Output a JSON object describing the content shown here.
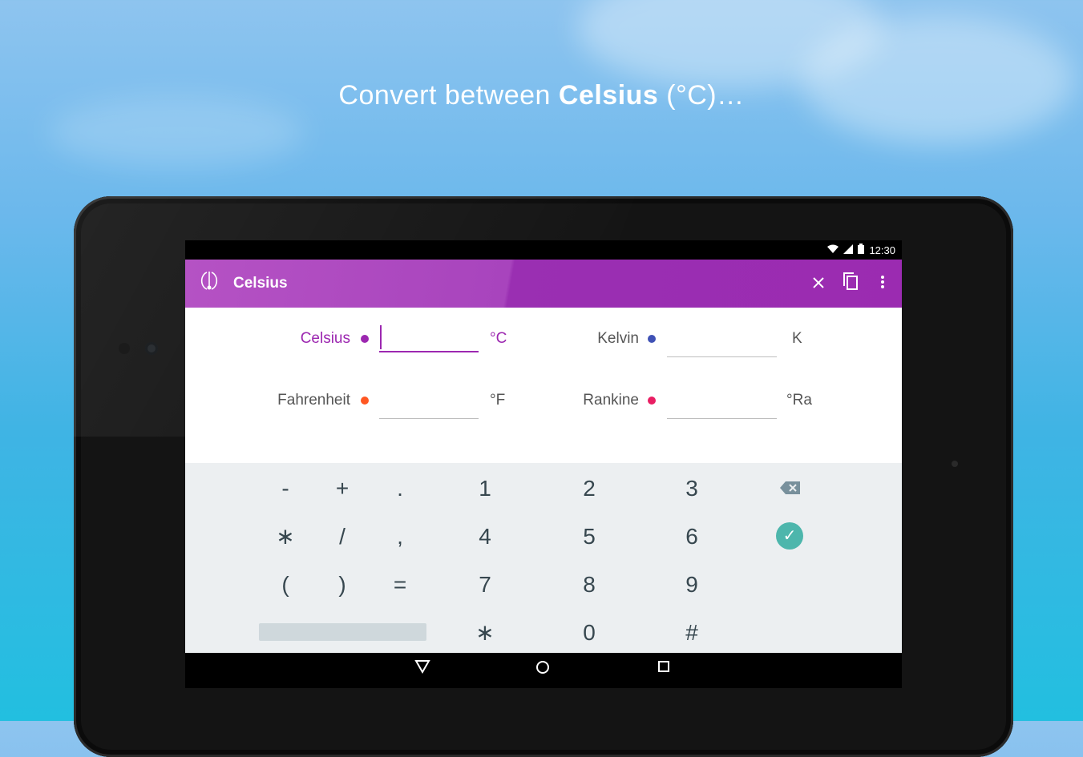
{
  "headline": {
    "prefix": "Convert between ",
    "bold": "Celsius",
    "suffix": " (°C)…"
  },
  "status_bar": {
    "time": "12:30"
  },
  "app_bar": {
    "title": "Celsius",
    "logo_icon": "thermometer-icon",
    "close_icon": "close-icon",
    "copy_icon": "copy-icon",
    "menu_icon": "more-vert-icon"
  },
  "fields": [
    {
      "label": "Celsius",
      "unit": "°C",
      "value": "",
      "dot_color": "#9c27b0",
      "active": true
    },
    {
      "label": "Kelvin",
      "unit": "K",
      "value": "",
      "dot_color": "#3f51b5",
      "active": false
    },
    {
      "label": "Fahrenheit",
      "unit": "°F",
      "value": "",
      "dot_color": "#ff5722",
      "active": false
    },
    {
      "label": "Rankine",
      "unit": "°Ra",
      "value": "",
      "dot_color": "#e91e63",
      "active": false
    }
  ],
  "keypad": {
    "row1": [
      "-",
      "+",
      ".",
      "1",
      "2",
      "3"
    ],
    "row2": [
      "∗",
      "/",
      ",",
      "4",
      "5",
      "6"
    ],
    "row3": [
      "(",
      ")",
      "=",
      "7",
      "8",
      "9"
    ],
    "row4": [
      "∗",
      "0",
      "#"
    ],
    "check_symbol": "✓",
    "backspace_icon": "backspace-icon",
    "check_icon": "check-circle-icon"
  },
  "nav": {
    "back_icon": "back-triangle-icon",
    "home_icon": "home-circle-icon",
    "recents_icon": "recents-square-icon"
  },
  "colors": {
    "accent": "#9c27b0",
    "appbar": "#9c27b0",
    "check": "#4db6ac",
    "keypad_bg": "#eceff1"
  }
}
